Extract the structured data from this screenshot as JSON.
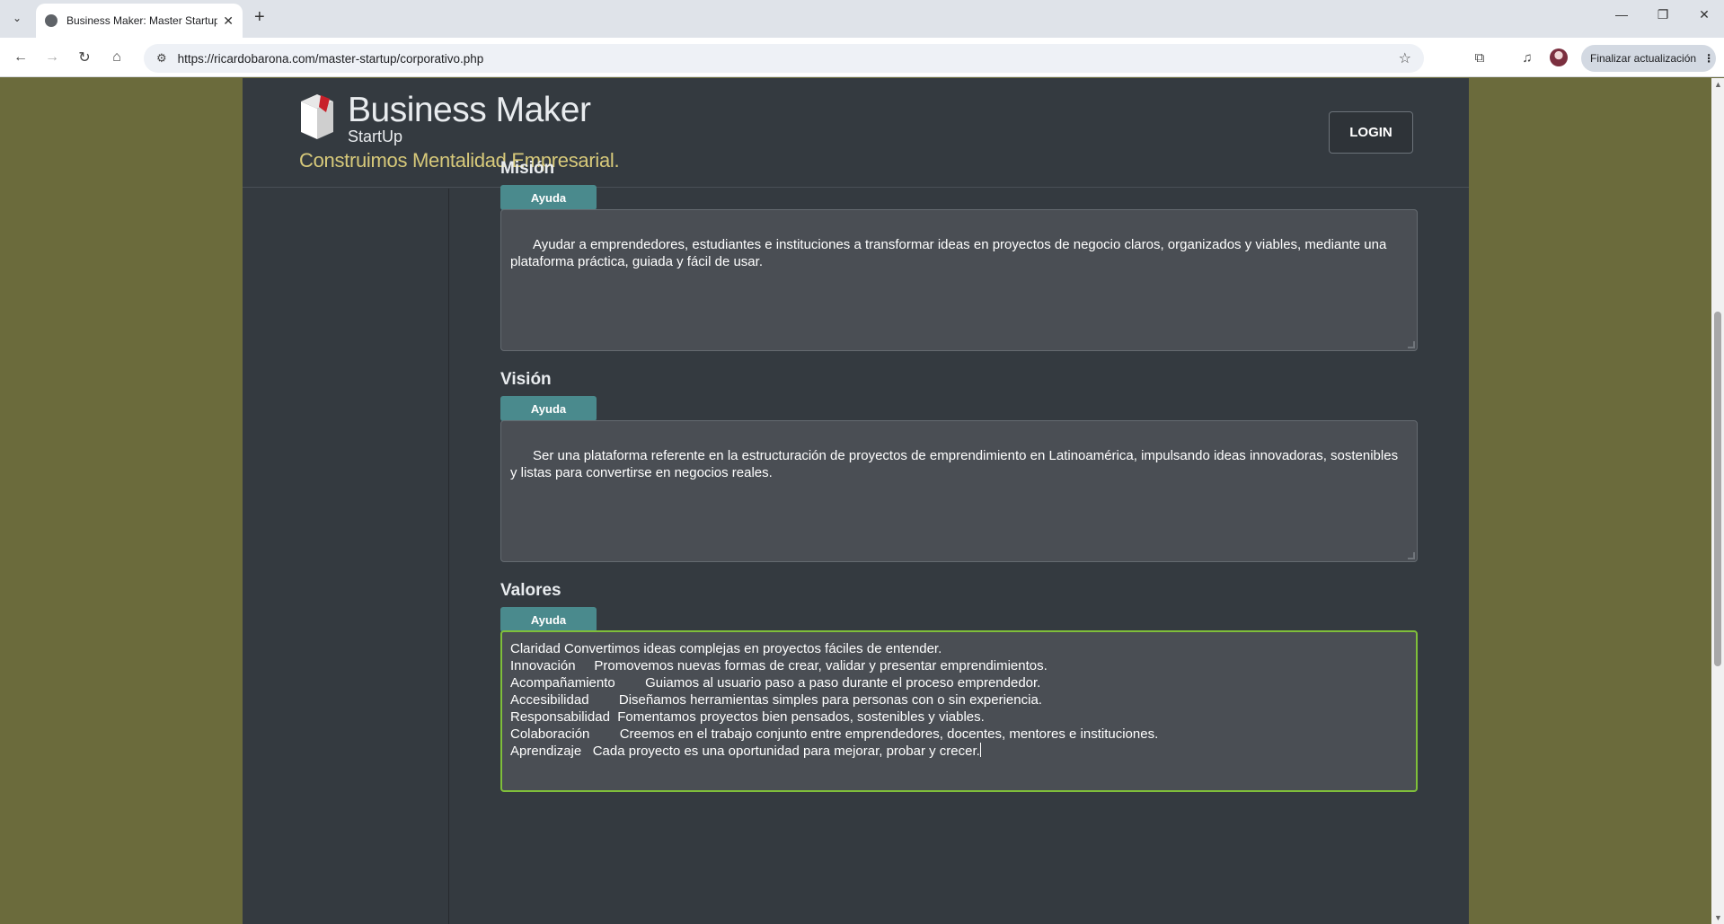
{
  "browser": {
    "tab_title": "Business Maker: Master Startup",
    "new_tab_icon": "plus-icon",
    "url": "https://ricardobarona.com/master-startup/corporativo.php",
    "update_button_label": "Finalizar actualización",
    "window_controls": {
      "minimize": "—",
      "restore": "❐",
      "close": "✕"
    }
  },
  "header": {
    "brand_name": "Business Maker",
    "brand_sub": "StartUp",
    "tagline": "Construimos Mentalidad Empresarial.",
    "login_label": "LOGIN"
  },
  "sections": {
    "mision": {
      "title": "Misión",
      "help_label": "Ayuda",
      "text": "Ayudar a emprendedores, estudiantes e instituciones a transformar ideas en proyectos de negocio claros, organizados y viables, mediante una plataforma práctica, guiada y fácil de usar."
    },
    "vision": {
      "title": "Visión",
      "help_label": "Ayuda",
      "text": "Ser una plataforma referente en la estructuración de proyectos de emprendimiento en Latinoamérica, impulsando ideas innovadoras, sostenibles y listas para convertirse en negocios reales."
    },
    "valores": {
      "title": "Valores",
      "help_label": "Ayuda",
      "text": "Claridad Convertimos ideas complejas en proyectos fáciles de entender.\nInnovación     Promovemos nuevas formas de crear, validar y presentar emprendimientos.\nAcompañamiento        Guiamos al usuario paso a paso durante el proceso emprendedor.\nAccesibilidad        Diseñamos herramientas simples para personas con o sin experiencia.\nResponsabilidad  Fomentamos proyectos bien pensados, sostenibles y viables.\nColaboración        Creemos en el trabajo conjunto entre emprendedores, docentes, mentores e instituciones.\nAprendizaje   Cada proyecto es una oportunidad para mejorar, probar y crecer."
    }
  },
  "colors": {
    "page_background": "#6b6b3c",
    "panel": "#343a40",
    "help_button": "#4a8a8d",
    "tagline": "#d7c97a",
    "focus_border": "#7fbf3a"
  }
}
